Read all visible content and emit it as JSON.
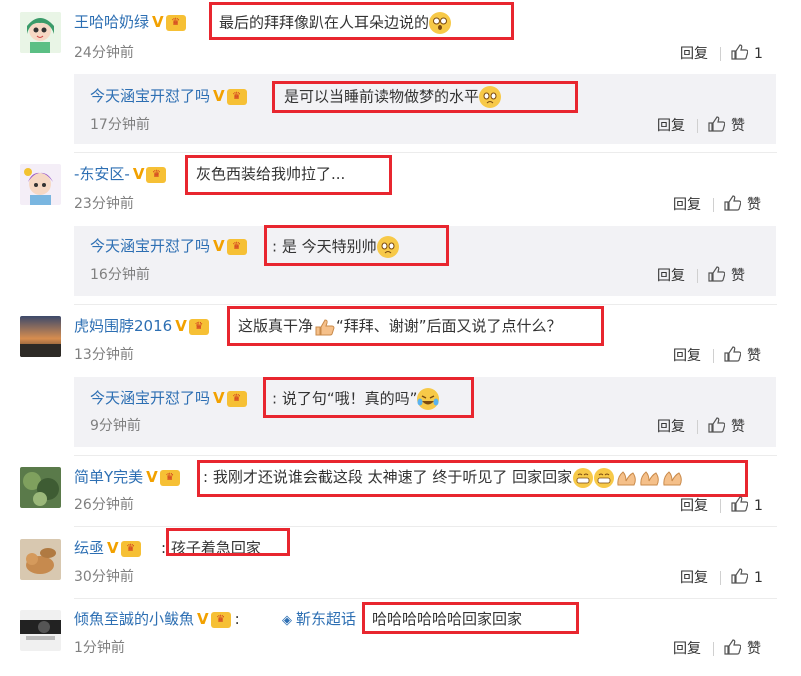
{
  "labels": {
    "reply": "回复",
    "like": "赞"
  },
  "comments": [
    {
      "user": "王哈哈奶绿",
      "text": "最后的拜拜像趴在人耳朵边说的",
      "time": "24分钟前",
      "likes": "1",
      "reply": {
        "user": "今天涵宝开怼了吗",
        "text": "是可以当睡前读物做梦的水平",
        "time": "17分钟前"
      }
    },
    {
      "user": "-东安区-",
      "text": "灰色西装给我帅拉了...",
      "time": "23分钟前",
      "likes": "赞",
      "reply": {
        "user": "今天涵宝开怼了吗",
        "text": ": 是 今天特别帅",
        "time": "16分钟前"
      }
    },
    {
      "user": "虎妈围脖2016",
      "text": "这版真干净",
      "text2": "“拜拜、谢谢”后面又说了点什么？",
      "time": "13分钟前",
      "likes": "赞",
      "reply": {
        "user": "今天涵宝开怼了吗",
        "text": ": 说了句“哦！真的吗”",
        "time": "9分钟前"
      }
    },
    {
      "user": "简单Y完美",
      "text": ": 我刚才还说谁会截这段 太神速了 终于听见了 回家回家",
      "time": "26分钟前",
      "likes": "1"
    },
    {
      "user": "纭亟",
      "text": ": 孩子着急回家",
      "time": "30分钟前",
      "likes": "1"
    },
    {
      "user": "倾魚至誠的小鲅魚",
      "prefix": ":",
      "topic": "靳东超话",
      "text": "哈哈哈哈哈哈回家回家",
      "time": "1分钟前",
      "likes": "赞"
    }
  ],
  "colors": {
    "username": "#2d6fb3",
    "highlight": "#e8262f",
    "reply_bg": "#f2f2f5",
    "time": "#808080"
  },
  "icons": [
    "v-badge-icon",
    "crown-badge-icon",
    "thumbs-up-icon",
    "emoji-icon",
    "topic-diamond-icon"
  ]
}
